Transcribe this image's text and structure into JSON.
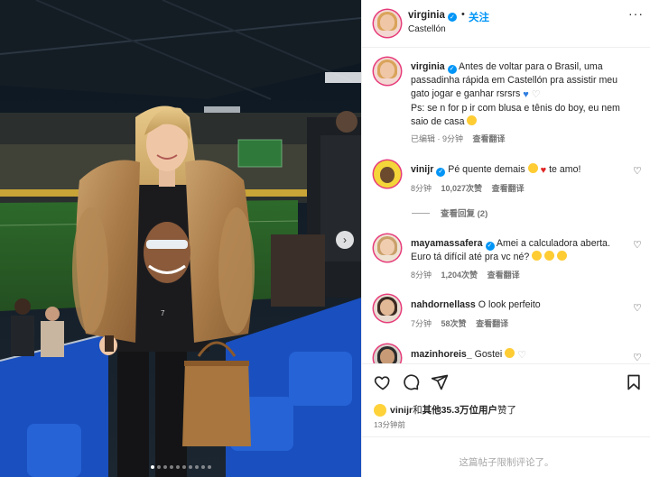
{
  "header": {
    "username": "virginia",
    "dot": "•",
    "follow_label": "关注",
    "location": "Castellón",
    "more_label": "···"
  },
  "photo": {
    "next_label": "›",
    "slide_count": 10,
    "active_slide": 1
  },
  "caption": {
    "username": "virginia",
    "text_1": "Antes de voltar para o Brasil, uma passadinha rápida em Castellón pra assistir meu gato jogar e ganhar rsrsrs",
    "text_2": "Ps: se n for p ir com blusa e tênis do boy, eu nem saio de casa",
    "edited_label": "已编辑 · 9分钟",
    "translate_label": "查看翻译"
  },
  "comments": [
    {
      "username": "vinijr",
      "text": "Pé quente demais",
      "text_end": "te amo!",
      "time": "8分钟",
      "likes": "10,027次赞",
      "translate": "查看翻译"
    },
    {
      "username": "mayamassafera",
      "text": "Amei a calculadora aberta. Euro tá difícil até pra vc né?",
      "time": "8分钟",
      "likes": "1,204次赞",
      "translate": "查看翻译"
    },
    {
      "username": "nahdornellass",
      "text": "O look perfeito",
      "time": "7分钟",
      "likes": "58次赞",
      "translate": "查看翻译"
    },
    {
      "username": "mazinhoreis_",
      "text": "Gostei"
    }
  ],
  "replies_label": "查看回复 (2)",
  "likes": {
    "user": "vinijr",
    "rest": "和",
    "bold_count": "其他35.3万位用户",
    "suffix": "赞了"
  },
  "post_time": "13分钟前",
  "footer_text": "这篇帖子限制评论了。",
  "colors": {
    "accent_blue": "#0095f6",
    "secondary_text": "#737373",
    "heart_red": "#e02424"
  }
}
